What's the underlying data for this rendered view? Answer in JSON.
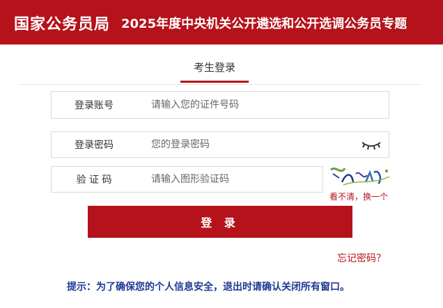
{
  "header": {
    "org_name": "国家公务员局",
    "title": "2025年度中央机关公开遴选和公开选调公务员专题"
  },
  "tab": {
    "label": "考生登录"
  },
  "form": {
    "account": {
      "label": "登录账号",
      "placeholder": "请输入您的证件号码"
    },
    "password": {
      "label": "登录密码",
      "placeholder": "您的登录密码",
      "toggle_icon": "eye-closed-icon"
    },
    "captcha": {
      "label": "验 证 码",
      "placeholder": "请输入图形验证码",
      "refresh_text": "看不清，换一个"
    },
    "login_button": "登 录",
    "forgot_password": "忘记密码？"
  },
  "tip": "提示：为了确保您的个人信息安全，退出时请确认关闭所有窗口。",
  "colors": {
    "brand_red": "#b5121b",
    "tip_blue": "#1f3a93"
  }
}
